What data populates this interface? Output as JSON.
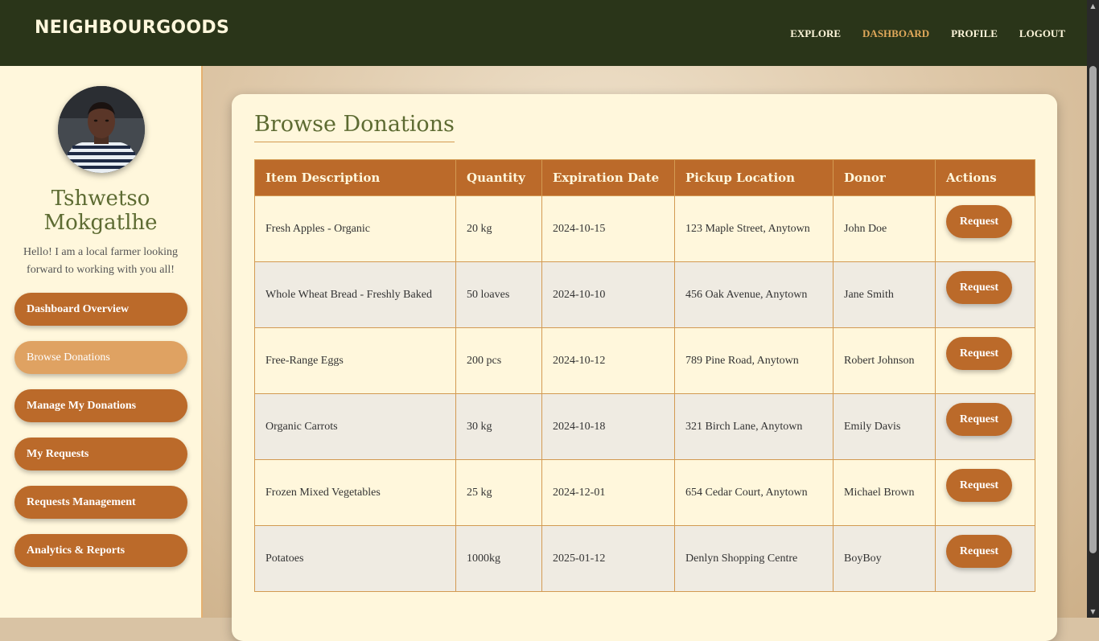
{
  "brand": "NEIGHBOURGOODS",
  "nav": [
    {
      "label": "EXPLORE",
      "active": false
    },
    {
      "label": "DASHBOARD",
      "active": true
    },
    {
      "label": "PROFILE",
      "active": false
    },
    {
      "label": "LOGOUT",
      "active": false
    }
  ],
  "profile": {
    "name": "Tshwetso Mokgatlhe",
    "bio": "Hello! I am a local farmer looking forward to working with you all!"
  },
  "sidebar": {
    "items": [
      {
        "label": "Dashboard Overview",
        "active": false
      },
      {
        "label": "Browse Donations",
        "active": true
      },
      {
        "label": "Manage My Donations",
        "active": false
      },
      {
        "label": "My Requests",
        "active": false
      },
      {
        "label": "Requests Management",
        "active": false
      },
      {
        "label": "Analytics & Reports",
        "active": false
      }
    ]
  },
  "main": {
    "title": "Browse Donations",
    "table": {
      "headers": [
        "Item Description",
        "Quantity",
        "Expiration Date",
        "Pickup Location",
        "Donor",
        "Actions"
      ],
      "rows": [
        {
          "item": "Fresh Apples - Organic",
          "quantity": "20 kg",
          "expiration": "2024-10-15",
          "location": "123 Maple Street, Anytown",
          "donor": "John Doe",
          "action": "Request"
        },
        {
          "item": "Whole Wheat Bread - Freshly Baked",
          "quantity": "50 loaves",
          "expiration": "2024-10-10",
          "location": "456 Oak Avenue, Anytown",
          "donor": "Jane Smith",
          "action": "Request"
        },
        {
          "item": "Free-Range Eggs",
          "quantity": "200 pcs",
          "expiration": "2024-10-12",
          "location": "789 Pine Road, Anytown",
          "donor": "Robert Johnson",
          "action": "Request"
        },
        {
          "item": "Organic Carrots",
          "quantity": "30 kg",
          "expiration": "2024-10-18",
          "location": "321 Birch Lane, Anytown",
          "donor": "Emily Davis",
          "action": "Request"
        },
        {
          "item": "Frozen Mixed Vegetables",
          "quantity": "25 kg",
          "expiration": "2024-12-01",
          "location": "654 Cedar Court, Anytown",
          "donor": "Michael Brown",
          "action": "Request"
        },
        {
          "item": "Potatoes",
          "quantity": "1000kg",
          "expiration": "2025-01-12",
          "location": "Denlyn Shopping Centre",
          "donor": "BoyBoy",
          "action": "Request"
        }
      ]
    }
  },
  "colors": {
    "header_bg": "#2a3519",
    "accent": "#bb6a2a",
    "accent_active": "#dfa262",
    "nav_active": "#e0a85a",
    "card_bg": "#fff7dc",
    "title_green": "#5d6b32"
  },
  "icons": {
    "avatar": "user-avatar-photo",
    "scroll_up": "scroll-up-arrow-icon",
    "scroll_down": "scroll-down-arrow-icon"
  }
}
